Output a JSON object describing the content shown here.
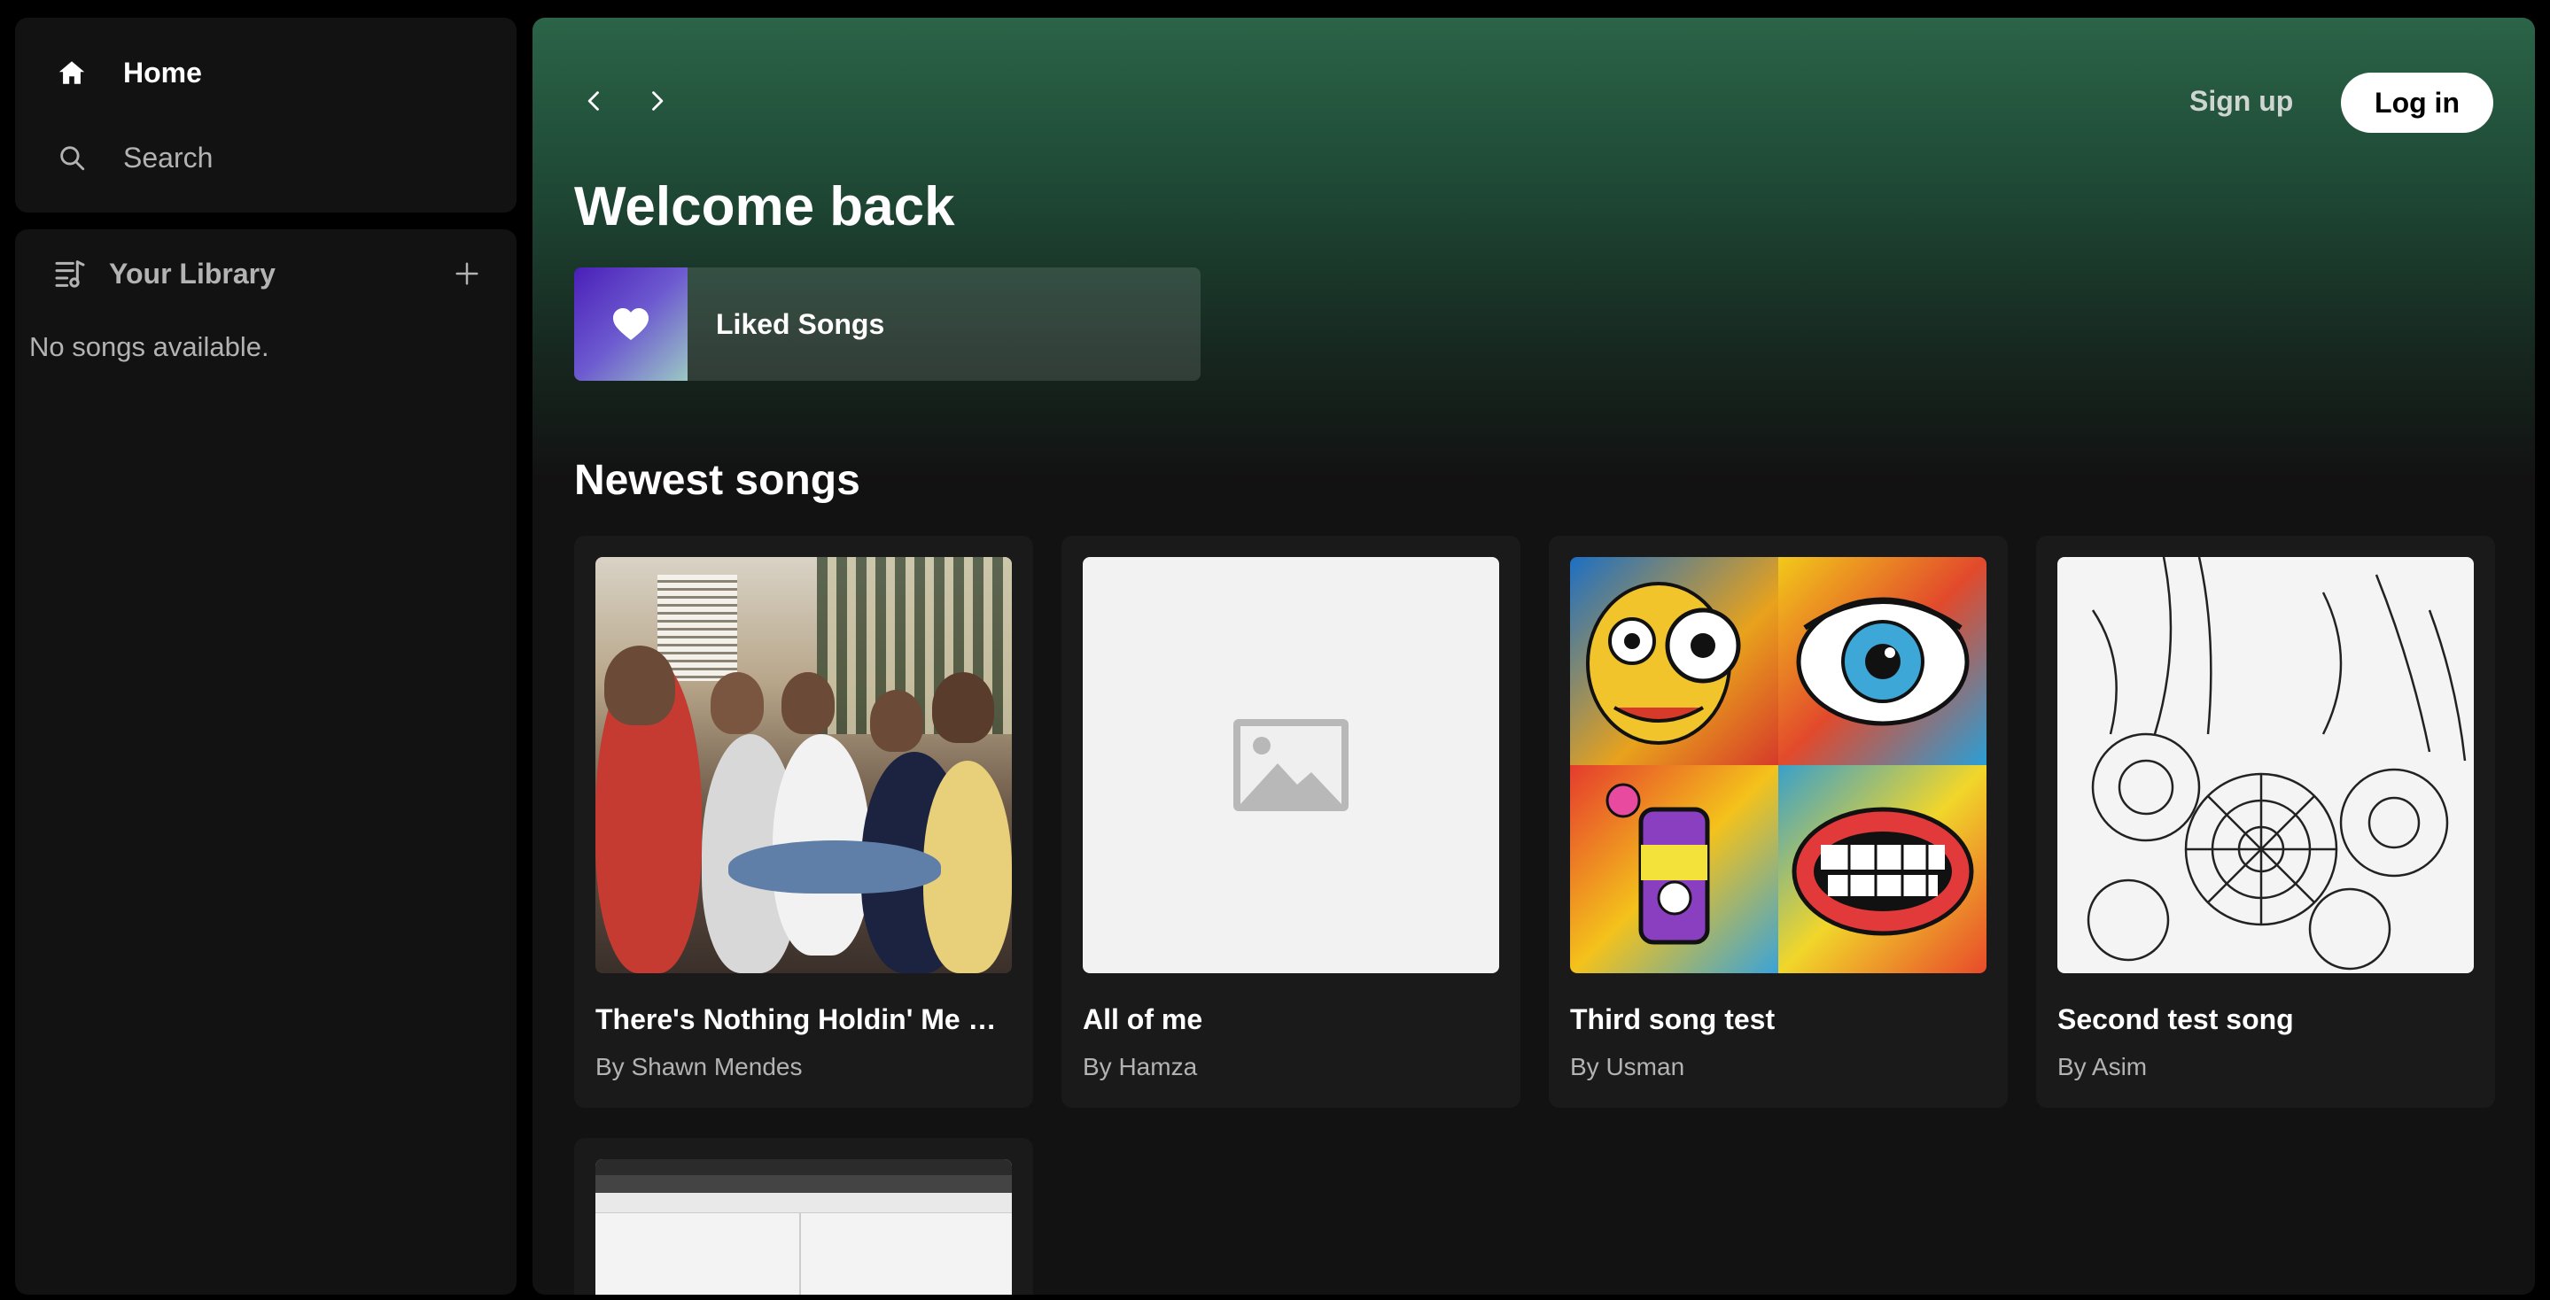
{
  "sidebar": {
    "nav": {
      "home_label": "Home",
      "search_label": "Search"
    },
    "library": {
      "title": "Your Library",
      "empty_text": "No songs available."
    }
  },
  "header": {
    "signup_label": "Sign up",
    "login_label": "Log in"
  },
  "main": {
    "welcome_title": "Welcome back",
    "liked_songs_label": "Liked Songs",
    "newest_title": "Newest songs",
    "songs": [
      {
        "title": "There's Nothing Holdin' Me Ba...",
        "artist": "By Shawn Mendes"
      },
      {
        "title": "All of me",
        "artist": "By Hamza"
      },
      {
        "title": "Third song test",
        "artist": "By Usman"
      },
      {
        "title": "Second test song",
        "artist": "By Asim"
      }
    ]
  },
  "colors": {
    "accent_green": "#2b6448",
    "panel": "#121212",
    "card": "#1a1a1a"
  }
}
